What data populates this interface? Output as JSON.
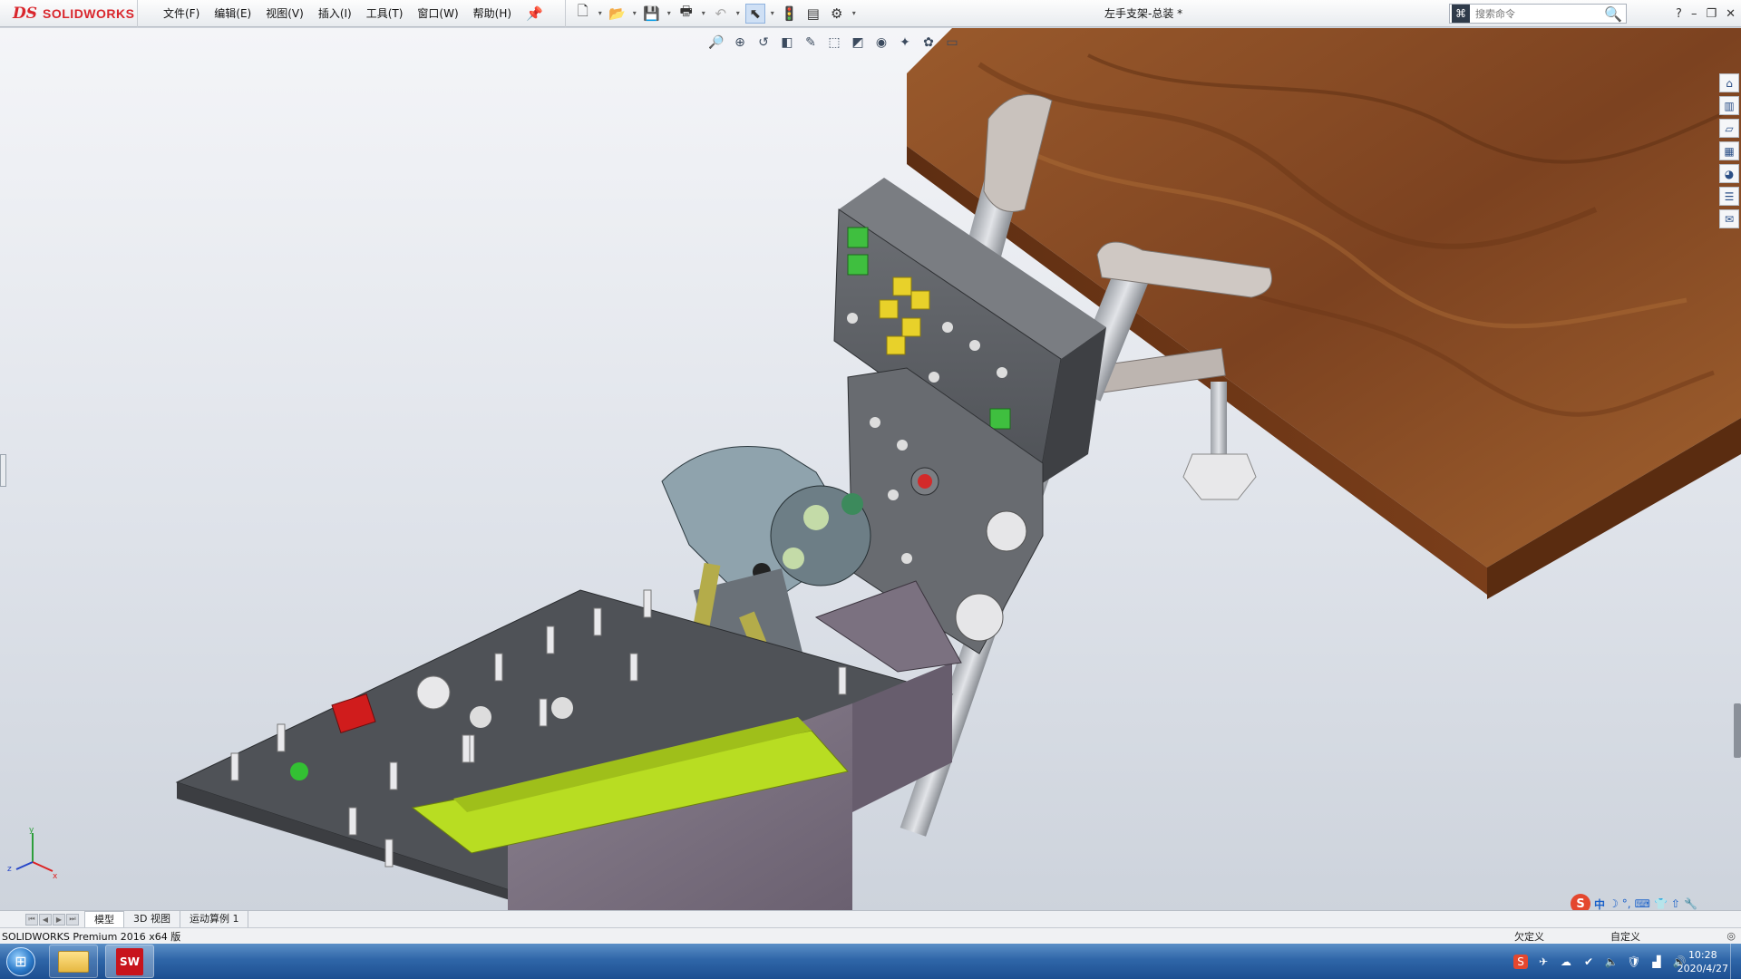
{
  "app": {
    "logo_ds": "DS",
    "logo_name": "SOLIDWORKS",
    "document_title": "左手支架-总装 *"
  },
  "menu": {
    "items": [
      "文件(F)",
      "编辑(E)",
      "视图(V)",
      "插入(I)",
      "工具(T)",
      "窗口(W)",
      "帮助(H)"
    ]
  },
  "search": {
    "placeholder": "搜索命令"
  },
  "window_controls": {
    "help": "?",
    "minimize": "–",
    "restore": "❐",
    "close": "✕"
  },
  "tabs": {
    "items": [
      "模型",
      "3D 视图",
      "运动算例 1"
    ],
    "active": "模型"
  },
  "status": {
    "product": "SOLIDWORKS Premium 2016 x64 版",
    "definition": "欠定义",
    "units": "自定义"
  },
  "ime": {
    "logo": "S",
    "mode": "中"
  },
  "taskbar": {
    "sw_label": "SW"
  },
  "clock": {
    "time": "10:28",
    "date": "2020/4/27"
  },
  "triad": {
    "x": "x",
    "y": "y",
    "z": "z"
  },
  "colors": {
    "title_red": "#d9262c",
    "wood": "#8a4a22",
    "panel_grey": "#5e6166",
    "bracket_mauve": "#7d7280",
    "accent_lime": "#c8e820",
    "taskbar_blue": "#2f66a8"
  },
  "icons": {
    "quick_access": [
      "new-icon",
      "open-icon",
      "save-icon",
      "print-icon",
      "undo-icon",
      "select-icon",
      "rebuild-icon",
      "file-properties-icon",
      "options-icon"
    ],
    "headsup": [
      "zoom-to-fit-icon",
      "zoom-area-icon",
      "previous-view-icon",
      "section-view-icon",
      "dynamic-annotation-icon",
      "view-orientation-icon",
      "display-style-icon",
      "hide-show-icon",
      "edit-appearance-icon",
      "apply-scene-icon",
      "view-settings-icon"
    ],
    "task_pane": [
      "home-icon",
      "design-library-icon",
      "file-explorer-icon",
      "view-palette-icon",
      "appearances-icon",
      "custom-properties-icon",
      "forum-icon"
    ]
  }
}
